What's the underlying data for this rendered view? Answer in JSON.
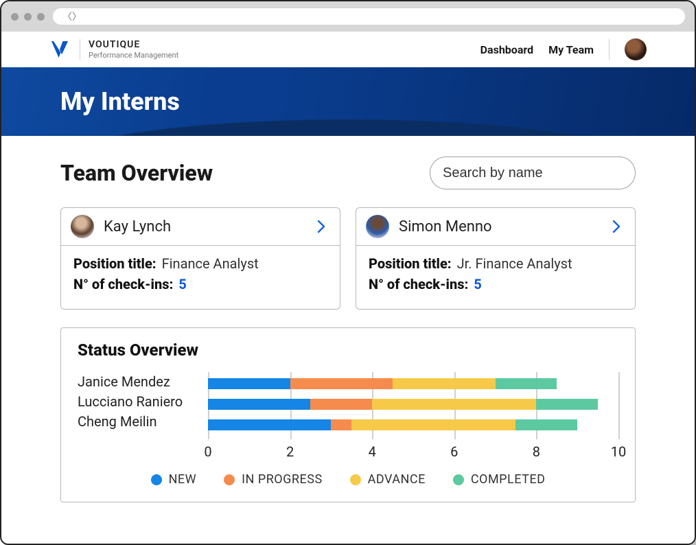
{
  "brand": {
    "name": "VOUTIQUE",
    "subtitle": "Performance Management"
  },
  "nav": {
    "dashboard": "Dashboard",
    "myteam": "My Team"
  },
  "banner": {
    "title": "My Interns"
  },
  "overview": {
    "title": "Team Overview"
  },
  "search": {
    "placeholder": "Search by name"
  },
  "cards": [
    {
      "name": "Kay Lynch",
      "position_label": "Position title:",
      "position_value": "Finance Analyst",
      "checkins_label": "N° of check-ins:",
      "checkins_value": "5"
    },
    {
      "name": "Simon Menno",
      "position_label": "Position title:",
      "position_value": "Jr. Finance Analyst",
      "checkins_label": "N° of check-ins:",
      "checkins_value": "5"
    }
  ],
  "status": {
    "title": "Status Overview",
    "legend": {
      "new": "NEW",
      "in_progress": "IN PROGRESS",
      "advance": "ADVANCE",
      "completed": "COMPLETED"
    },
    "axis_ticks": [
      "0",
      "2",
      "4",
      "6",
      "8",
      "10"
    ]
  },
  "chart_data": {
    "type": "bar",
    "orientation": "horizontal-stacked",
    "xlabel": "",
    "ylabel": "",
    "xlim": [
      0,
      10
    ],
    "x_ticks": [
      0,
      2,
      4,
      6,
      8,
      10
    ],
    "categories": [
      "Janice Mendez",
      "Lucciano Raniero",
      "Cheng Meilin"
    ],
    "series": [
      {
        "name": "NEW",
        "color": "#1585e6",
        "values": [
          2.0,
          2.5,
          3.0
        ]
      },
      {
        "name": "IN PROGRESS",
        "color": "#f58b4c",
        "values": [
          2.5,
          1.5,
          0.5
        ]
      },
      {
        "name": "ADVANCE",
        "color": "#f7c949",
        "values": [
          2.5,
          4.0,
          4.0
        ]
      },
      {
        "name": "COMPLETED",
        "color": "#5cc9a0",
        "values": [
          1.5,
          1.5,
          1.5
        ]
      }
    ],
    "legend_position": "bottom",
    "grid": true
  }
}
